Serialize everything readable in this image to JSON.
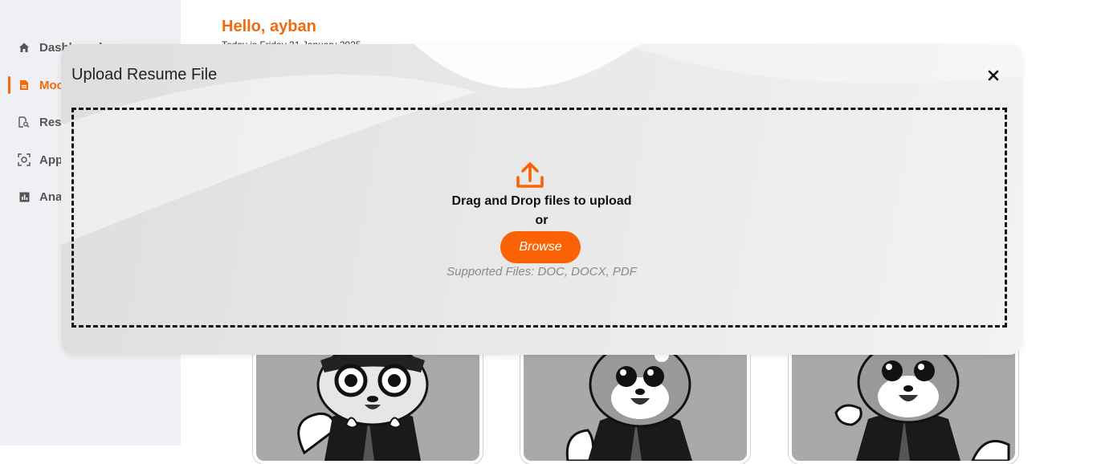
{
  "sidebar": {
    "items": [
      {
        "label": "Dashboard",
        "icon": "home-icon"
      },
      {
        "label": "Mock Interview",
        "icon": "document-icon"
      },
      {
        "label": "Resume Analysis",
        "icon": "search-document-icon"
      },
      {
        "label": "Application Tracker",
        "icon": "scan-icon"
      },
      {
        "label": "Analytics",
        "icon": "chart-icon"
      }
    ]
  },
  "header": {
    "greeting": "Hello, ayban",
    "date": "Today is Friday 31 January 2025"
  },
  "modal": {
    "title": "Upload Resume File",
    "close_icon": "close-icon",
    "upload_icon": "upload-icon",
    "drag_text": "Drag and Drop files to upload",
    "or_text": "or",
    "browse_label": "Browse",
    "supported_text": "Supported Files: DOC, DOCX, PDF"
  },
  "colors": {
    "accent": "#f26a0c",
    "button": "#fa6205",
    "sidebar_bg": "#eff0f3"
  }
}
